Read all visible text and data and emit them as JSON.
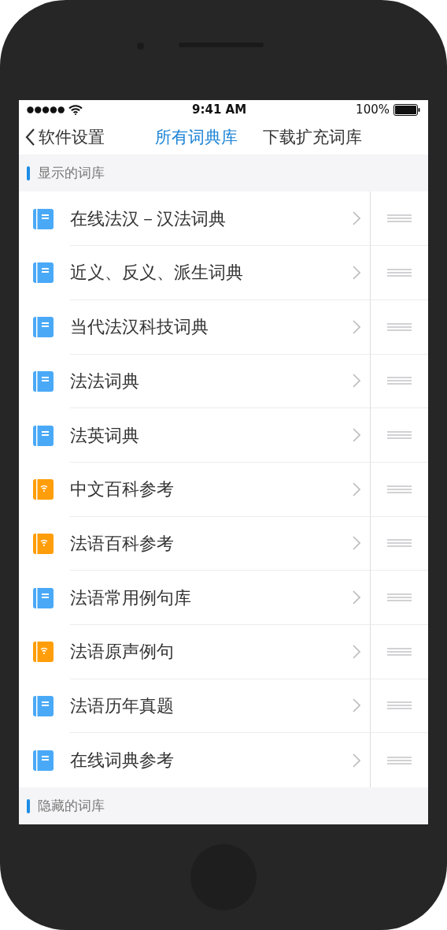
{
  "status_bar": {
    "time": "9:41 AM",
    "battery": "100%"
  },
  "nav": {
    "back": "软件设置",
    "tabs": [
      {
        "label": "所有词典库",
        "selected": true
      },
      {
        "label": "下载扩充词库",
        "selected": false
      }
    ]
  },
  "sections": [
    {
      "title": "显示的词库",
      "items": [
        {
          "name": "在线法汉－汉法词典",
          "kind": "book"
        },
        {
          "name": "近义、反义、派生词典",
          "kind": "book"
        },
        {
          "name": "当代法汉科技词典",
          "kind": "book"
        },
        {
          "name": "法法词典",
          "kind": "book"
        },
        {
          "name": "法英词典",
          "kind": "book"
        },
        {
          "name": "中文百科参考",
          "kind": "online"
        },
        {
          "name": "法语百科参考",
          "kind": "online"
        },
        {
          "name": "法语常用例句库",
          "kind": "book"
        },
        {
          "name": "法语原声例句",
          "kind": "online"
        },
        {
          "name": "法语历年真题",
          "kind": "book"
        },
        {
          "name": "在线词典参考",
          "kind": "book"
        }
      ]
    },
    {
      "title": "隐藏的词库"
    }
  ]
}
